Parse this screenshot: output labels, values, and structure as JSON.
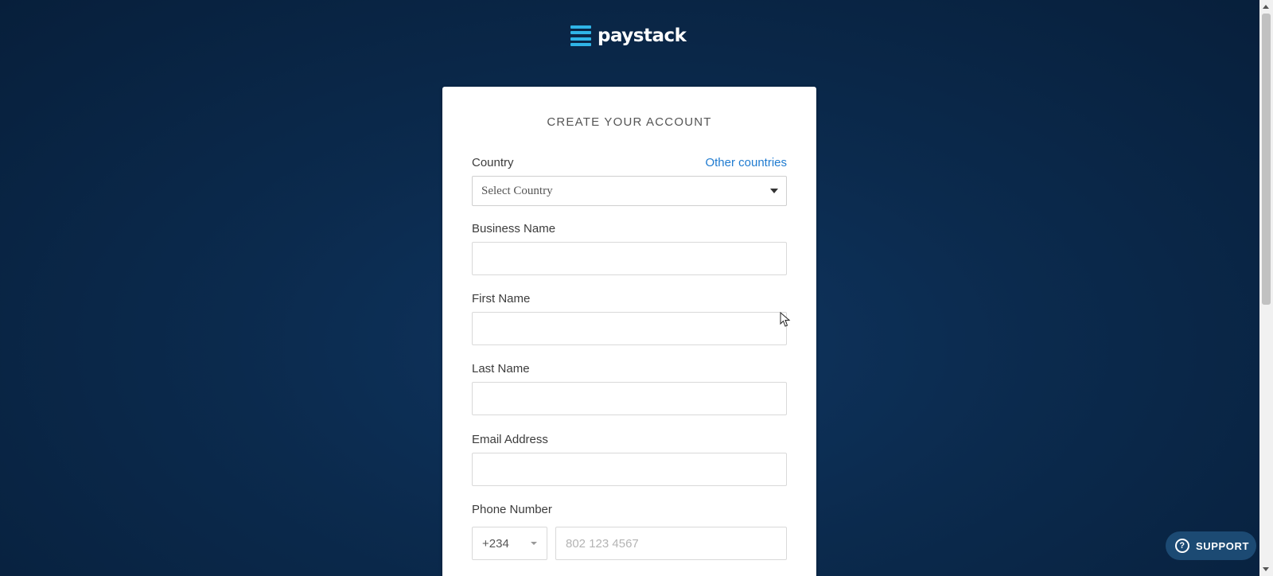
{
  "brand": {
    "name": "paystack",
    "accent_color": "#2fb4e7"
  },
  "form": {
    "title": "CREATE YOUR ACCOUNT",
    "country": {
      "label": "Country",
      "other_link": "Other countries",
      "selected": "Select Country"
    },
    "business_name": {
      "label": "Business Name"
    },
    "first_name": {
      "label": "First Name"
    },
    "last_name": {
      "label": "Last Name"
    },
    "email": {
      "label": "Email Address"
    },
    "phone": {
      "label": "Phone Number",
      "country_code": "+234",
      "placeholder": "802 123 4567"
    }
  },
  "support": {
    "label": "SUPPORT",
    "icon": "question-circle-icon"
  },
  "colors": {
    "link": "#1f7bd0",
    "background": "#0b2a4d"
  }
}
